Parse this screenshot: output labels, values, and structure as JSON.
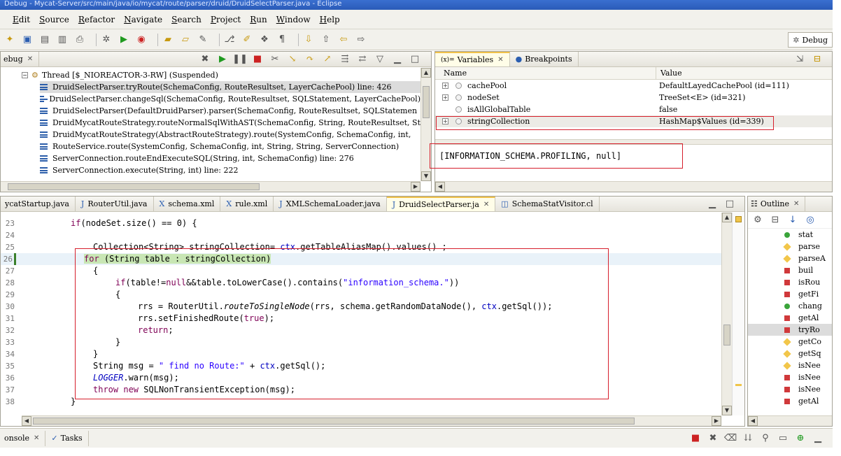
{
  "window": {
    "title": "Debug - Mycat-Server/src/main/java/io/mycat/route/parser/druid/DruidSelectParser.java - Eclipse"
  },
  "menu": [
    "Edit",
    "Source",
    "Refactor",
    "Navigate",
    "Search",
    "Project",
    "Run",
    "Window",
    "Help"
  ],
  "perspective": {
    "label": "Debug"
  },
  "debug_view": {
    "tab_label": "ebug",
    "thread": "Thread [$_NIOREACTOR-3-RW] (Suspended)",
    "frames": [
      "DruidSelectParser.tryRoute(SchemaConfig, RouteResultset, LayerCachePool) line: 426",
      "DruidSelectParser.changeSql(SchemaConfig, RouteResultset, SQLStatement, LayerCachePool)",
      "DruidSelectParser(DefaultDruidParser).parser(SchemaConfig, RouteResultset, SQLStatemen",
      "DruidMycatRouteStrategy.routeNormalSqlWithAST(SchemaConfig, String, RouteResultset, St",
      "DruidMycatRouteStrategy(AbstractRouteStrategy).route(SystemConfig, SchemaConfig, int,",
      "RouteService.route(SystemConfig, SchemaConfig, int, String, String, ServerConnection)",
      "ServerConnection.routeEndExecuteSQL(String, int, SchemaConfig) line: 276",
      "ServerConnection.execute(String, int) line: 222"
    ]
  },
  "variables_view": {
    "tabs": [
      "Variables",
      "Breakpoints"
    ],
    "columns": [
      "Name",
      "Value"
    ],
    "rows": [
      {
        "name": "cachePool",
        "value": "DefaultLayedCachePool  (id=111)",
        "expandable": true
      },
      {
        "name": "nodeSet",
        "value": "TreeSet<E>  (id=321)",
        "expandable": true
      },
      {
        "name": "isAllGlobalTable",
        "value": "false",
        "expandable": false
      },
      {
        "name": "stringCollection",
        "value": "HashMap$Values  (id=339)",
        "expandable": true
      }
    ],
    "detail": "[INFORMATION_SCHEMA.PROFILING, null]"
  },
  "editor_tabs": [
    "MycatStartup.java",
    "RouterUtil.java",
    "schema.xml",
    "rule.xml",
    "XMLSchemaLoader.java",
    "DruidSelectParser.ja",
    "SchemaStatVisitor.cl"
  ],
  "editor_tab_labels": {
    "mycat": "ycatStartup.java",
    "router": "RouterUtil.java",
    "schema": "schema.xml",
    "rule": "rule.xml",
    "xmlloader": "XMLSchemaLoader.java",
    "druid": "DruidSelectParser.ja",
    "visitor": "SchemaStatVisitor.cl"
  },
  "code": {
    "line_numbers": [
      "23",
      "24",
      "25",
      "26",
      "27",
      "28",
      "29",
      "30",
      "31",
      "32",
      "33",
      "34",
      "35",
      "36",
      "37",
      "38"
    ],
    "l23_a": "if",
    "l23_b": "(nodeSet.size() == 0) {",
    "l25": "Collection<String> stringCollection= ",
    "l25_b": "ctx",
    "l25_c": ".getTableAliasMap().values() ;",
    "l26_a": "for",
    "l26_b": " (String table : stringCollection)",
    "l27": "{",
    "l28_a": "if",
    "l28_b": "(table!=",
    "l28_c": "null",
    "l28_d": "&&table.toLowerCase().contains(",
    "l28_e": "\"information_schema.\"",
    "l28_f": "))",
    "l29": "{",
    "l30_a": "rrs = RouterUtil.",
    "l30_b": "routeToSingleNode",
    "l30_c": "(rrs, schema.getRandomDataNode(), ",
    "l30_d": "ctx",
    "l30_e": ".getSql());",
    "l31_a": "rrs.setFinishedRoute(",
    "l31_b": "true",
    "l31_c": ");",
    "l32": "return",
    "l32_b": ";",
    "l33": "}",
    "l34": "}",
    "l35_a": "String msg = ",
    "l35_b": "\" find no Route:\"",
    "l35_c": " + ",
    "l35_d": "ctx",
    "l35_e": ".getSql();",
    "l36_a": "LOGGER",
    "l36_b": ".warn(msg);",
    "l37_a": "throw",
    "l37_b": " ",
    "l37_c": "new",
    "l37_d": " SQLNonTransientException(msg);",
    "l38": "}"
  },
  "outline": {
    "tab_label": "Outline",
    "items": [
      {
        "label": "stat",
        "marker": "green"
      },
      {
        "label": "parse",
        "marker": "yellow"
      },
      {
        "label": "parseA",
        "marker": "yellow"
      },
      {
        "label": "buil",
        "marker": "red"
      },
      {
        "label": "isRou",
        "marker": "red"
      },
      {
        "label": "getFi",
        "marker": "red"
      },
      {
        "label": "chang",
        "marker": "green"
      },
      {
        "label": "getAl",
        "marker": "red"
      },
      {
        "label": "tryRo",
        "marker": "red"
      },
      {
        "label": "getCo",
        "marker": "yellow"
      },
      {
        "label": "getSq",
        "marker": "yellow"
      },
      {
        "label": "isNee",
        "marker": "yellow"
      },
      {
        "label": "isNee",
        "marker": "red"
      },
      {
        "label": "isNee",
        "marker": "red"
      },
      {
        "label": "getAl",
        "marker": "red"
      }
    ]
  },
  "bottom_tabs": {
    "console": "onsole",
    "tasks": "Tasks"
  }
}
